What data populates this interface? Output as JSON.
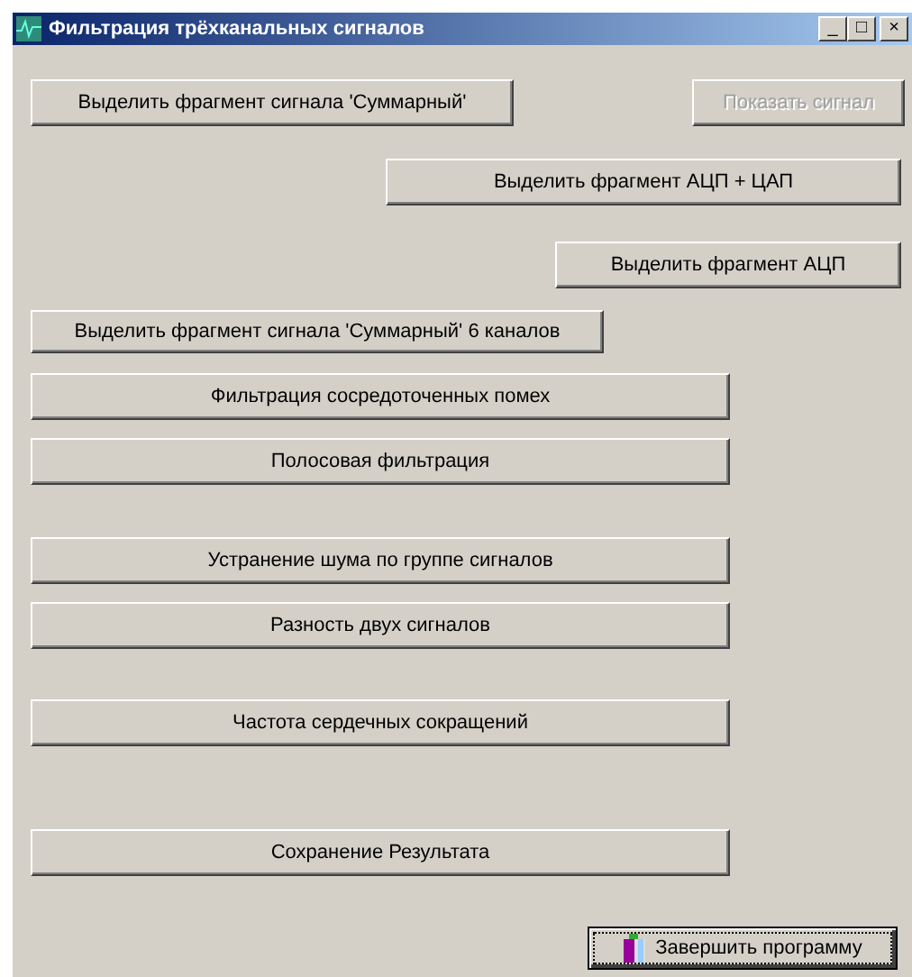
{
  "window": {
    "title": "Фильтрация трёхканальных сигналов",
    "controls": [
      "_",
      "□",
      "×"
    ]
  },
  "buttons": [
    {
      "label": "Выделить фрагмент сигнала 'Суммарный'",
      "disabled": false,
      "focused": false
    },
    {
      "label": "Показать сигнал",
      "disabled": true,
      "focused": false
    },
    {
      "label": "Выделить фрагмент АЦП + ЦАП",
      "disabled": false,
      "focused": false
    },
    {
      "label": "Выделить фрагмент АЦП",
      "disabled": false,
      "focused": false
    },
    {
      "label": "Выделить фрагмент сигнала 'Суммарный' 6 каналов",
      "disabled": false,
      "focused": false
    },
    {
      "label": "Фильтрация сосредоточенных помех",
      "disabled": false,
      "focused": false
    },
    {
      "label": "Полосовая фильтрация",
      "disabled": false,
      "focused": false
    },
    {
      "label": "Устранение шума по группе сигналов",
      "disabled": false,
      "focused": false
    },
    {
      "label": "Разность двух сигналов",
      "disabled": false,
      "focused": false
    },
    {
      "label": "Частота сердечных сокращений",
      "disabled": false,
      "focused": false
    },
    {
      "label": "Сохранение Результата",
      "disabled": false,
      "focused": false
    },
    {
      "label": "Завершить программу",
      "disabled": false,
      "focused": true,
      "kind": "icon"
    }
  ]
}
